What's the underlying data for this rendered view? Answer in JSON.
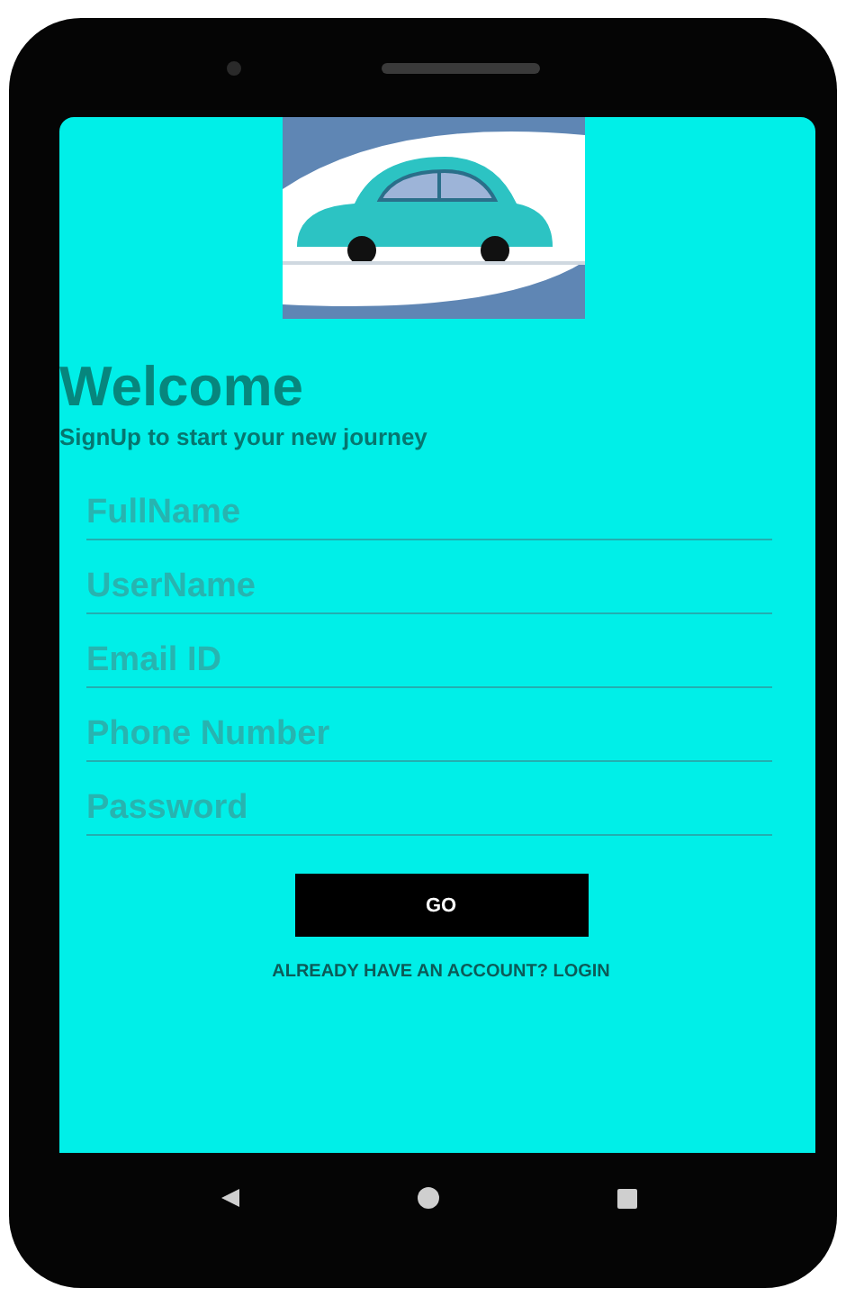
{
  "header": {
    "title": "Welcome",
    "subtitle": "SignUp to start your new journey"
  },
  "fields": [
    {
      "placeholder": "FullName"
    },
    {
      "placeholder": "UserName"
    },
    {
      "placeholder": "Email ID"
    },
    {
      "placeholder": "Phone Number"
    },
    {
      "placeholder": "Password"
    }
  ],
  "submit_button": {
    "label": "GO"
  },
  "login_link": {
    "label": "ALREADY HAVE AN ACCOUNT? LOGIN"
  }
}
